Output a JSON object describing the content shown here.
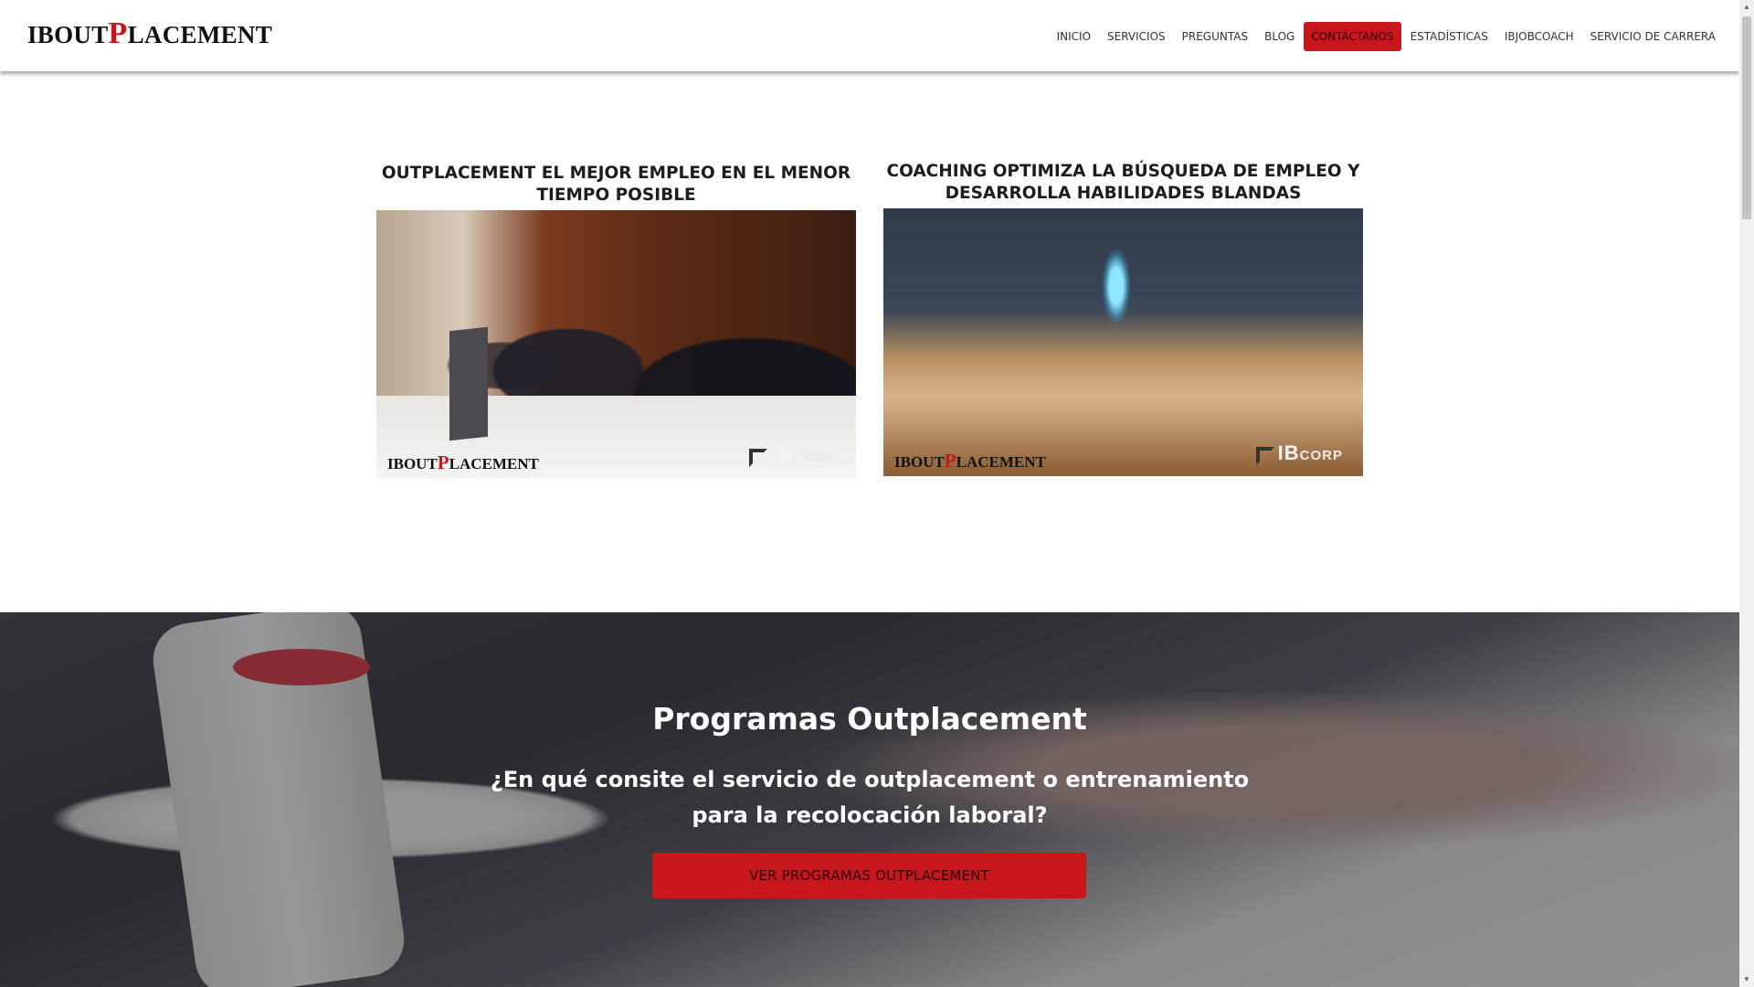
{
  "header": {
    "logo": {
      "part1": "IBOUT",
      "part2": "P",
      "part3": "LACEMENT"
    },
    "nav": [
      {
        "label": "INICIO"
      },
      {
        "label": "SERVICIOS"
      },
      {
        "label": "PREGUNTAS"
      },
      {
        "label": "BLOG"
      },
      {
        "label": "CONTÁCTANOS",
        "active": true
      },
      {
        "label": "ESTADÍSTICAS"
      },
      {
        "label": "IBJOBCOACH"
      },
      {
        "label": "SERVICIO DE CARRERA"
      }
    ]
  },
  "cards": [
    {
      "title": "OUTPLACEMENT EL MEJOR EMPLEO EN EL MENOR TIEMPO POSIBLE",
      "watermark": {
        "part1": "IBOUT",
        "part2": "P",
        "part3": "LACEMENT"
      },
      "corp": {
        "ib": "IB",
        "corp": "CORP"
      }
    },
    {
      "title": "COACHING OPTIMIZA LA BÚSQUEDA DE EMPLEO Y DESARROLLA HABILIDADES BLANDAS",
      "watermark": {
        "part1": "IBOUT",
        "part2": "P",
        "part3": "LACEMENT"
      },
      "corp": {
        "ib": "IB",
        "corp": "CORP"
      }
    }
  ],
  "hero": {
    "title": "Programas Outplacement",
    "subtitle": "¿En qué consite el servicio de outplacement o entrenamiento para la recolocación laboral?",
    "button_label": "VER PROGRAMAS OUTPLACEMENT"
  },
  "colors": {
    "brand_red": "#c8161d"
  },
  "icons": {
    "scroll_up": "triangle-up-icon",
    "scroll_down": "triangle-down-icon"
  }
}
